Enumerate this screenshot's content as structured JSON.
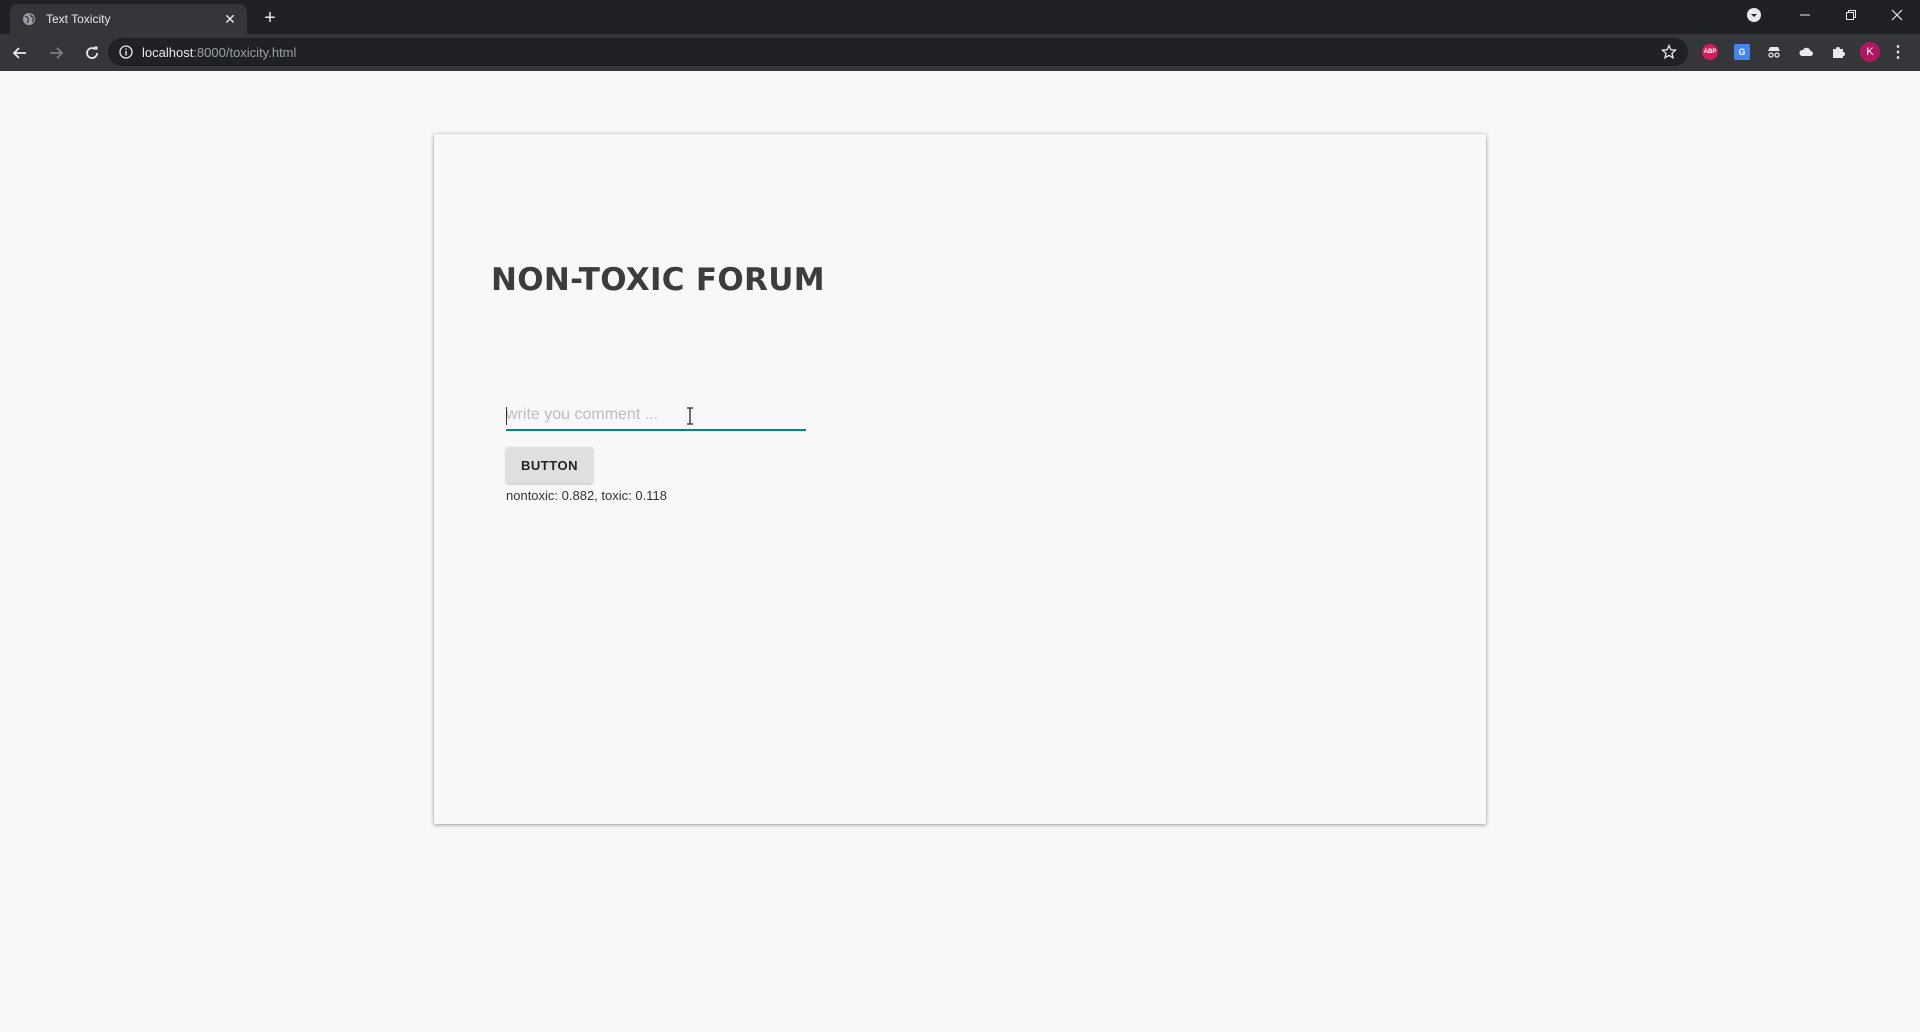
{
  "browser": {
    "tab_title": "Text Toxicity",
    "url_host": "localhost",
    "url_rest": ":8000/toxicity.html",
    "profile_initial": "K",
    "abp_label": "ABP"
  },
  "page": {
    "title": "NON-TOXIC FORUM",
    "comment_placeholder": "write you comment ...",
    "comment_value": "",
    "button_label": "BUTTON",
    "result_text": "nontoxic: 0.882, toxic: 0.118"
  },
  "colors": {
    "input_underline": "#00897b",
    "avatar": "#b0175f"
  }
}
